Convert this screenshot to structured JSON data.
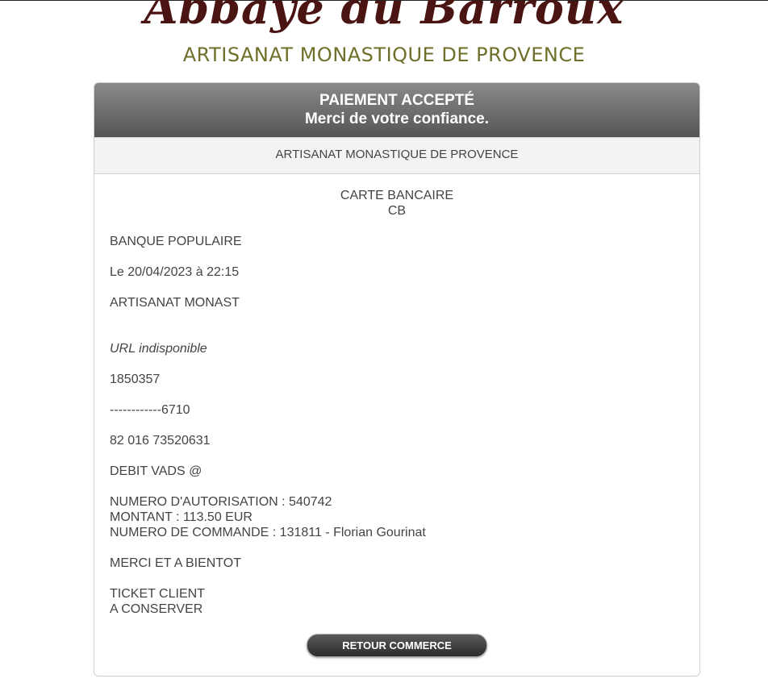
{
  "logo": {
    "title": "Abbaye du Barroux",
    "subtitle": "ARTISANAT MONASTIQUE DE PROVENCE"
  },
  "header": {
    "title": "PAIEMENT ACCEPTÉ",
    "subtitle": "Merci de votre confiance."
  },
  "merchant_bar": "ARTISANAT MONASTIQUE DE PROVENCE",
  "ticket": {
    "card_type_line1": "CARTE BANCAIRE",
    "card_type_line2": "CB",
    "bank": "BANQUE POPULAIRE",
    "datetime": "Le 20/04/2023 à 22:15",
    "shop": "ARTISANAT MONAST",
    "url": "URL indisponible",
    "merchant_number": "1850357",
    "card_number": "------------6710",
    "reference": "82 016 73520631",
    "debit": "DEBIT VADS @",
    "authorization": "NUMERO D'AUTORISATION : 540742",
    "amount": "MONTANT : 113.50 EUR",
    "order": "NUMERO DE COMMANDE : 131811 - Florian Gourinat",
    "thanks": "MERCI ET A BIENTOT",
    "ticket_line1": "TICKET CLIENT",
    "ticket_line2": "A CONSERVER"
  },
  "button": {
    "label": "RETOUR COMMERCE"
  }
}
